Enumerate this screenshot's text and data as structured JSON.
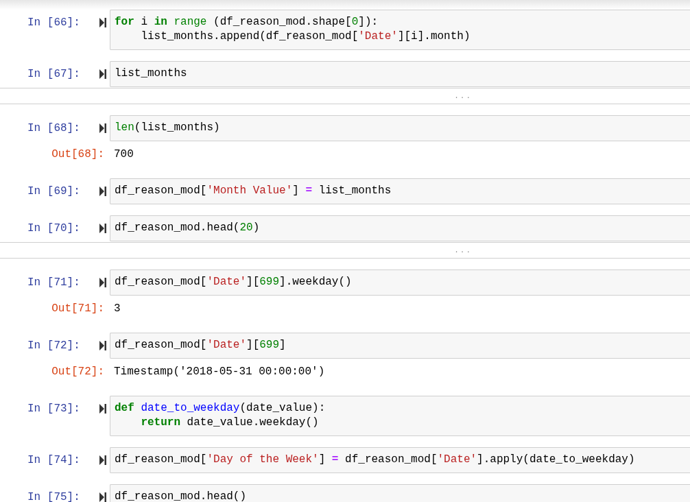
{
  "cells": [
    {
      "prompt": "In [66]:",
      "lines": [
        {
          "indented": false,
          "tokens": [
            {
              "kind": "kw",
              "text": "for"
            },
            {
              "kind": "plain",
              "text": " i "
            },
            {
              "kind": "kw",
              "text": "in"
            },
            {
              "kind": "builtin",
              "text": " range"
            },
            {
              "kind": "plain",
              "text": " (df_reason_mod.shape["
            },
            {
              "kind": "num",
              "text": "0"
            },
            {
              "kind": "plain",
              "text": "]):"
            }
          ]
        },
        {
          "indented": true,
          "tokens": [
            {
              "kind": "plain",
              "text": "list_months.append(df_reason_mod["
            },
            {
              "kind": "str",
              "text": "'Date'"
            },
            {
              "kind": "plain",
              "text": "][i].month)"
            }
          ]
        }
      ]
    },
    {
      "prompt": "In [67]:",
      "lines": [
        {
          "indented": false,
          "tokens": [
            {
              "kind": "plain",
              "text": "list_months"
            }
          ]
        }
      ],
      "collapsed": "..."
    },
    {
      "prompt": "In [68]:",
      "lines": [
        {
          "indented": false,
          "tokens": [
            {
              "kind": "builtin",
              "text": "len"
            },
            {
              "kind": "plain",
              "text": "(list_months)"
            }
          ]
        }
      ],
      "output": {
        "prompt": "Out[68]:",
        "text": "700"
      }
    },
    {
      "prompt": "In [69]:",
      "lines": [
        {
          "indented": false,
          "tokens": [
            {
              "kind": "plain",
              "text": "df_reason_mod["
            },
            {
              "kind": "str",
              "text": "'Month Value'"
            },
            {
              "kind": "plain",
              "text": "] "
            },
            {
              "kind": "op",
              "text": "="
            },
            {
              "kind": "plain",
              "text": " list_months"
            }
          ]
        }
      ]
    },
    {
      "prompt": "In [70]:",
      "lines": [
        {
          "indented": false,
          "tokens": [
            {
              "kind": "plain",
              "text": "df_reason_mod.head("
            },
            {
              "kind": "num",
              "text": "20"
            },
            {
              "kind": "plain",
              "text": ")"
            }
          ]
        }
      ],
      "collapsed": "..."
    },
    {
      "prompt": "In [71]:",
      "lines": [
        {
          "indented": false,
          "tokens": [
            {
              "kind": "plain",
              "text": "df_reason_mod["
            },
            {
              "kind": "str",
              "text": "'Date'"
            },
            {
              "kind": "plain",
              "text": "]["
            },
            {
              "kind": "num",
              "text": "699"
            },
            {
              "kind": "plain",
              "text": "].weekday()"
            }
          ]
        }
      ],
      "output": {
        "prompt": "Out[71]:",
        "text": "3"
      }
    },
    {
      "prompt": "In [72]:",
      "lines": [
        {
          "indented": false,
          "tokens": [
            {
              "kind": "plain",
              "text": "df_reason_mod["
            },
            {
              "kind": "str",
              "text": "'Date'"
            },
            {
              "kind": "plain",
              "text": "]["
            },
            {
              "kind": "num",
              "text": "699"
            },
            {
              "kind": "plain",
              "text": "]"
            }
          ]
        }
      ],
      "output": {
        "prompt": "Out[72]:",
        "text": "Timestamp('2018-05-31 00:00:00')"
      }
    },
    {
      "prompt": "In [73]:",
      "lines": [
        {
          "indented": false,
          "tokens": [
            {
              "kind": "kw",
              "text": "def"
            },
            {
              "kind": "def",
              "text": " date_to_weekday"
            },
            {
              "kind": "plain",
              "text": "(date_value):"
            }
          ]
        },
        {
          "indented": true,
          "tokens": [
            {
              "kind": "kw",
              "text": "return"
            },
            {
              "kind": "plain",
              "text": " date_value.weekday()"
            }
          ]
        }
      ]
    },
    {
      "prompt": "In [74]:",
      "lines": [
        {
          "indented": false,
          "tokens": [
            {
              "kind": "plain",
              "text": "df_reason_mod["
            },
            {
              "kind": "str",
              "text": "'Day of the Week'"
            },
            {
              "kind": "plain",
              "text": "] "
            },
            {
              "kind": "op",
              "text": "="
            },
            {
              "kind": "plain",
              "text": " df_reason_mod["
            },
            {
              "kind": "str",
              "text": "'Date'"
            },
            {
              "kind": "plain",
              "text": "].apply(date_to_weekday)"
            }
          ]
        }
      ]
    },
    {
      "prompt": "In [75]:",
      "lines": [
        {
          "indented": false,
          "tokens": [
            {
              "kind": "plain",
              "text": "df_reason_mod.head()"
            }
          ]
        }
      ]
    }
  ]
}
